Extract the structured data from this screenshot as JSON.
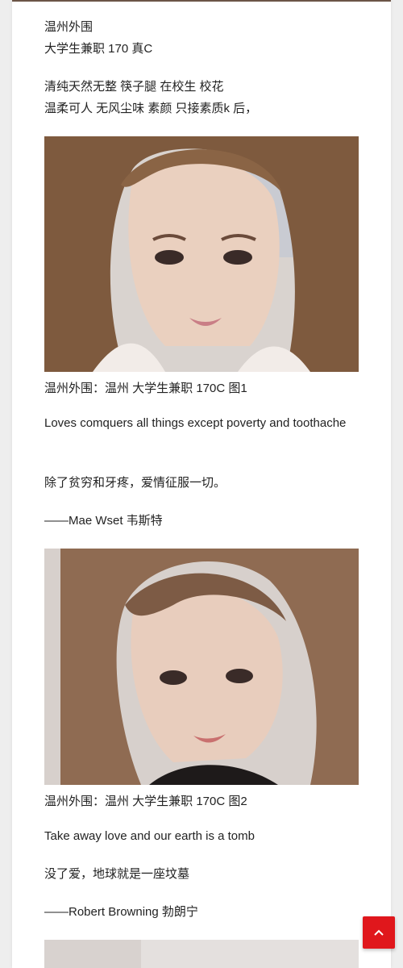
{
  "intro": {
    "line1": "温州外围",
    "line2": "大学生兼职 170 真C",
    "line3": "清纯天然无整 筷子腿 在校生 校花",
    "line4": "温柔可人 无风尘味 素颜 只接素质k 后，"
  },
  "photos": [
    {
      "caption": "温州外围：温州 大学生兼职 170C 图1"
    },
    {
      "caption": "温州外围：温州 大学生兼职 170C 图2"
    }
  ],
  "quotes": [
    {
      "english": "Loves comquers all things except poverty and toothache",
      "chinese": "除了贫穷和牙疼，爱情征服一切。",
      "author": "——Mae Wset 韦斯特"
    },
    {
      "english": "Take away love and our earth is a tomb",
      "chinese": "没了爱，地球就是一座坟墓",
      "author": "——Robert Browning 勃朗宁"
    }
  ],
  "back_to_top": {
    "icon": "chevron-up-icon",
    "color": "#e0171c"
  }
}
